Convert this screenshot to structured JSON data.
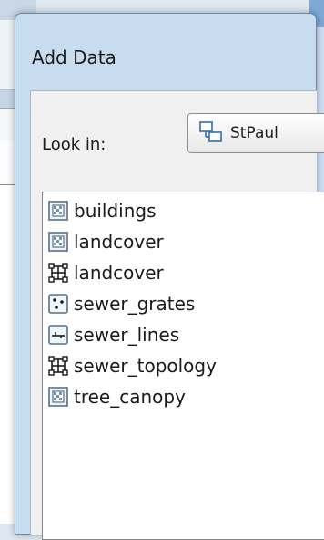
{
  "dialog": {
    "title": "Add Data",
    "look_in_label": "Look in:",
    "look_in_value": "StPaul"
  },
  "items": [
    {
      "label": "buildings",
      "icon": "raster-dataset-icon"
    },
    {
      "label": "landcover",
      "icon": "raster-dataset-icon"
    },
    {
      "label": "landcover",
      "icon": "topology-icon"
    },
    {
      "label": "sewer_grates",
      "icon": "point-feature-class-icon"
    },
    {
      "label": "sewer_lines",
      "icon": "line-feature-class-icon"
    },
    {
      "label": "sewer_topology",
      "icon": "topology-icon"
    },
    {
      "label": "tree_canopy",
      "icon": "raster-dataset-icon"
    }
  ],
  "colors": {
    "icon_blue": "#2f6fb0",
    "icon_border": "#5a6f86"
  }
}
